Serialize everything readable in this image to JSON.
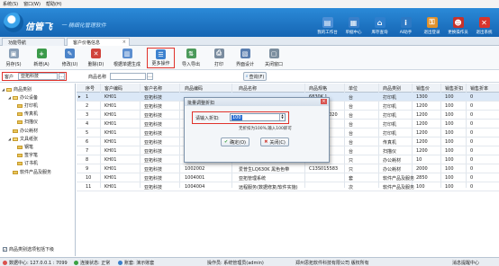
{
  "menu": [
    "系统(S)",
    "窗口(W)",
    "帮助(H)"
  ],
  "brand": {
    "name": "信管飞",
    "slogan": "一 精细化管理软件"
  },
  "top_tiles": [
    {
      "label": "我的工作台",
      "icon": "desk-icon",
      "color": "#4d8fd6",
      "glyph": "▤"
    },
    {
      "label": "单据中心",
      "icon": "doc-icon",
      "color": "#3a7fc9",
      "glyph": "▦"
    },
    {
      "label": "库存查询",
      "icon": "warehouse-icon",
      "color": "#2f7fcd",
      "glyph": "⌂"
    },
    {
      "label": "AI助手",
      "icon": "info-icon",
      "color": "#2d79c4",
      "glyph": "i"
    },
    {
      "label": "退出登录",
      "icon": "lock-icon",
      "color": "#e0912b",
      "glyph": "⚿"
    },
    {
      "label": "更换操作员",
      "icon": "user-icon",
      "color": "#c7322b",
      "glyph": "☻"
    },
    {
      "label": "退出系统",
      "icon": "exit-icon",
      "color": "#d8342c",
      "glyph": "✕"
    }
  ],
  "doc_tabs": [
    "功能导航",
    "客户价格信息"
  ],
  "toolbar": [
    {
      "label": "另存(S)",
      "icon": "save-icon",
      "color": "#8aa0b7",
      "glyph": "▣"
    },
    {
      "label": "新增(A)",
      "icon": "add-icon",
      "color": "#3b9a4a",
      "glyph": "+"
    },
    {
      "label": "修改(U)",
      "icon": "edit-icon",
      "color": "#4c84c9",
      "glyph": "✎"
    },
    {
      "label": "删除(D)",
      "icon": "delete-icon",
      "color": "#d0433b",
      "glyph": "✕"
    },
    {
      "label": "根据单据生成",
      "icon": "generate-icon",
      "color": "#5d8fd0",
      "glyph": "▥"
    },
    {
      "label": "更多操作",
      "icon": "more-icon",
      "color": "#3d82cf",
      "glyph": "☰"
    },
    {
      "label": "导入导出",
      "icon": "import-export-icon",
      "color": "#4c9a5b",
      "glyph": "⇅"
    },
    {
      "label": "打印",
      "icon": "print-icon",
      "color": "#7a8c9f",
      "glyph": "⎙"
    },
    {
      "label": "界面设计",
      "icon": "design-icon",
      "color": "#5b7fb0",
      "glyph": "▧"
    },
    {
      "label": "关闭窗口",
      "icon": "close-window-icon",
      "color": "#7b8e9f",
      "glyph": "▢"
    }
  ],
  "filter": {
    "customer_label": "客户",
    "customer_value": "亚拓科技",
    "product_label": "商品名称",
    "product_value": "",
    "query_label": "查询(F)"
  },
  "tree": {
    "nodes": [
      {
        "label": "商品类别",
        "level": 0,
        "open": true
      },
      {
        "label": "办公设备",
        "level": 1,
        "open": true
      },
      {
        "label": "打印机",
        "level": 2,
        "open": false
      },
      {
        "label": "传真机",
        "level": 2,
        "open": false
      },
      {
        "label": "扫描仪",
        "level": 2,
        "open": false
      },
      {
        "label": "办公耗材",
        "level": 1,
        "open": false
      },
      {
        "label": "文具纸张",
        "level": 1,
        "open": true
      },
      {
        "label": "钢笔",
        "level": 2,
        "open": false
      },
      {
        "label": "签字笔",
        "level": 2,
        "open": false
      },
      {
        "label": "订书机",
        "level": 2,
        "open": false
      },
      {
        "label": "软件产品及服务",
        "level": 1,
        "open": false
      }
    ],
    "footer": "商品类别选项包括下级"
  },
  "grid": {
    "columns": [
      "序号",
      "客户编码",
      "客户名称",
      "商品编码",
      "商品名称",
      "商品规格",
      "单位",
      "商品类别",
      "销售价",
      "销售折扣",
      "销售折率"
    ],
    "rows": [
      [
        "1",
        "KH01",
        "亚拓科技",
        "",
        "",
        "6830K ]",
        "台",
        "打印机",
        "1300",
        "100",
        "0"
      ],
      [
        "2",
        "KH01",
        "亚拓科技",
        "",
        "",
        "T1000K",
        "台",
        "打印机",
        "1200",
        "100",
        "0"
      ],
      [
        "3",
        "KH01",
        "亚拓科技",
        "",
        "",
        "aserJet 1020",
        "台",
        "打印机",
        "1200",
        "100",
        "0"
      ],
      [
        "4",
        "KH01",
        "亚拓科技",
        "",
        "",
        "",
        "台",
        "打印机",
        "1200",
        "100",
        "0"
      ],
      [
        "5",
        "KH01",
        "亚拓科技",
        "",
        "",
        "L 2900",
        "台",
        "打印机",
        "1200",
        "100",
        "0"
      ],
      [
        "6",
        "KH01",
        "亚拓科技",
        "",
        "",
        "FT862CN",
        "台",
        "传真机",
        "1200",
        "100",
        "0"
      ],
      [
        "7",
        "KH01",
        "亚拓科技",
        "100103001",
        "紫光平板扫描仪",
        "Uniscan",
        "台",
        "扫描仪",
        "1200",
        "100",
        "0"
      ],
      [
        "8",
        "KH01",
        "亚拓科技",
        "1002001",
        "喜屋CH5612Z圆珠笔",
        "802s",
        "只",
        "办公耗材",
        "10",
        "100",
        "0"
      ],
      [
        "9",
        "KH01",
        "亚拓科技",
        "1002002",
        "爱普生LQ630K 黑色色带",
        "C13S015583",
        "只",
        "办公耗材",
        "2000",
        "100",
        "0"
      ],
      [
        "10",
        "KH01",
        "亚拓科技",
        "1004001",
        "亚拓管理系统",
        "",
        "套",
        "软件产品及服务",
        "2850",
        "100",
        "0"
      ],
      [
        "11",
        "KH01",
        "亚拓科技",
        "1004004",
        "远程服务(数据修复/软件实施)",
        "",
        "次",
        "软件产品及服务",
        "100",
        "100",
        "0"
      ]
    ]
  },
  "dialog": {
    "title": "批量调整折扣",
    "label": "请输入折扣:",
    "value": "100",
    "hint": "无折扣为100%,输入100即可",
    "ok": "确定(O)",
    "cancel": "关闭(C)"
  },
  "status": [
    {
      "text": "数据中心: 127.0.0.1 : 7099",
      "color": "#d9534f"
    },
    {
      "text": "连接状态: 正常",
      "color": "#3aa142"
    },
    {
      "text": "账套: 演示账套",
      "color": "#3a7fc9"
    },
    {
      "text": "操作员: 系统管理员(admin)",
      "color": ""
    },
    {
      "text": "郑州思拓软件科技有限公司 版权所有",
      "color": ""
    },
    {
      "text": "消息提醒中心",
      "color": ""
    }
  ]
}
